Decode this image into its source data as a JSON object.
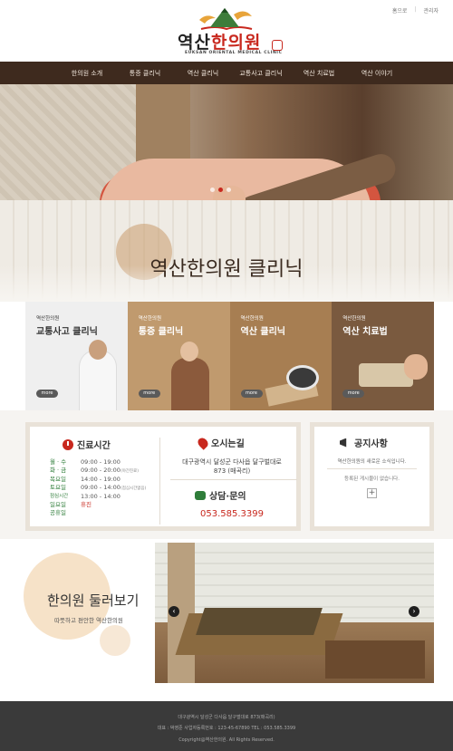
{
  "header": {
    "util_links": [
      "홈으로",
      "관리자"
    ],
    "logo_text_1": "역산",
    "logo_text_2": "한의원",
    "logo_en": "EUKSAN ORIENTAL MEDICAL CLINIC"
  },
  "nav": {
    "items": [
      "한의원 소개",
      "통증 클리닉",
      "역산 클리닉",
      "교통사고 클리닉",
      "역산 치료법",
      "역산 이야기"
    ]
  },
  "hero": {
    "slides_count": 3,
    "active_slide": 2
  },
  "clinic": {
    "title": "역산한의원 클리닉",
    "cards": [
      {
        "sub": "역산한의원",
        "title": "교통사고 클리닉",
        "more": "more"
      },
      {
        "sub": "역산한의원",
        "title": "통증 클리닉",
        "more": "more"
      },
      {
        "sub": "역산한의원",
        "title": "역산 클리닉",
        "more": "more"
      },
      {
        "sub": "역산한의원",
        "title": "역산 치료법",
        "more": "more"
      }
    ]
  },
  "hours": {
    "title": "진료시간",
    "rows": [
      {
        "day": "월 · 수",
        "time": "09:00 - 19:00",
        "note": ""
      },
      {
        "day": "화 · 금",
        "time": "09:00 - 20:00",
        "note": "(야간진료)"
      },
      {
        "day": "목요일",
        "time": "14:00 - 19:00",
        "note": ""
      },
      {
        "day": "토요일",
        "time": "09:00 - 14:00",
        "note": "(점심시간없음)"
      },
      {
        "day": "점심시간",
        "time": "13:00 - 14:00",
        "note": ""
      },
      {
        "day": "일요일",
        "time": "휴진",
        "note": ""
      },
      {
        "day": "공휴일",
        "time": "",
        "note": ""
      }
    ]
  },
  "location": {
    "title": "오시는길",
    "address_line1": "대구광역시 달성군 다사읍 달구벌대로",
    "address_line2": "873 (매곡리)"
  },
  "contact": {
    "title": "상담·문의",
    "phone": "053.585.3399"
  },
  "notice": {
    "title": "공지사항",
    "sub": "역산한의원의 새로운 소식입니다.",
    "empty": "등록된 게시물이 없습니다.",
    "plus": "+"
  },
  "tour": {
    "title": "한의원 둘러보기",
    "sub": "따뜻하고 편안한 역산한의원",
    "prev": "‹",
    "next": "›"
  },
  "footer": {
    "line1": "대구광역시 달성군 다사읍 달구벌대로 873(매곡리)",
    "line2": "대표 : 박영준     사업자등록번호 : 123-45-67890     TEL : 053.585.3399",
    "line3": "Copyright@역산한의원. All Rights Reserved."
  },
  "colors": {
    "brand_red": "#c8281e",
    "nav_bg": "#3e2a1e",
    "green": "#2f7d3a",
    "footer_bg": "#3a3a3a"
  }
}
